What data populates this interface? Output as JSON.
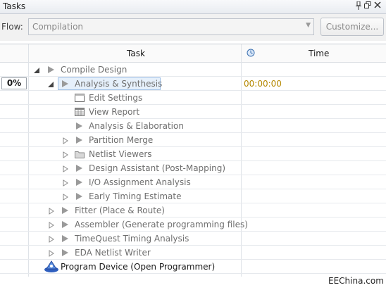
{
  "panel": {
    "title": "Tasks",
    "pin_icon": "pin-icon",
    "float_icon": "float-icon",
    "close_icon": "close-icon"
  },
  "flow": {
    "label": "Flow:",
    "value": "Compilation",
    "customize_label": "Customize..."
  },
  "table": {
    "columns": {
      "task": "Task",
      "time": "Time",
      "time_icon": "clock-icon"
    },
    "progress": "0%",
    "rows": [
      {
        "label": "Compile Design",
        "expander": "expanded",
        "icon": "play-icon",
        "muted": true
      },
      {
        "label": "Analysis & Synthesis",
        "expander": "expanded",
        "icon": "play-icon",
        "selected": true,
        "time": "00:00:00"
      },
      {
        "label": "Edit Settings",
        "icon": "settings-window-icon"
      },
      {
        "label": "View Report",
        "icon": "report-table-icon"
      },
      {
        "label": "Analysis & Elaboration",
        "icon": "play-icon"
      },
      {
        "label": "Partition Merge",
        "expander": "collapsed",
        "icon": "play-icon"
      },
      {
        "label": "Netlist Viewers",
        "expander": "collapsed",
        "icon": "folder-icon"
      },
      {
        "label": "Design Assistant (Post-Mapping)",
        "expander": "collapsed",
        "icon": "play-icon"
      },
      {
        "label": "I/O Assignment Analysis",
        "expander": "collapsed",
        "icon": "play-icon"
      },
      {
        "label": "Early Timing Estimate",
        "expander": "collapsed",
        "icon": "play-icon"
      },
      {
        "label": "Fitter (Place & Route)",
        "expander": "collapsed",
        "icon": "play-icon"
      },
      {
        "label": "Assembler (Generate programming files)",
        "expander": "collapsed",
        "icon": "play-icon"
      },
      {
        "label": "TimeQuest Timing Analysis",
        "expander": "collapsed",
        "icon": "play-icon"
      },
      {
        "label": "EDA Netlist Writer",
        "expander": "collapsed",
        "icon": "play-icon"
      },
      {
        "label": "Program Device (Open Programmer)",
        "icon": "programmer-icon",
        "dark": true
      }
    ]
  },
  "watermark": "EEChina.com"
}
